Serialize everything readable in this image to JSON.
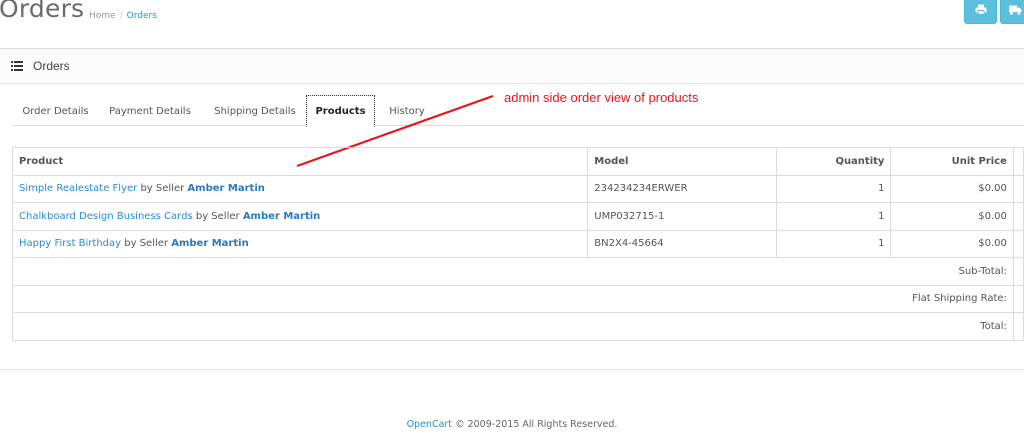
{
  "header": {
    "title": "Orders",
    "breadcrumb": {
      "home": "Home",
      "separator": "/",
      "current": "Orders"
    },
    "buttons": [
      {
        "name": "print-invoice",
        "icon": "print-icon"
      },
      {
        "name": "print-shipping",
        "icon": "truck-icon"
      }
    ]
  },
  "panel": {
    "icon": "list-icon",
    "title": "Orders",
    "tabs": [
      "Order Details",
      "Payment Details",
      "Shipping Details",
      "Products",
      "History"
    ],
    "active_tab": "Products"
  },
  "annotation": {
    "text": "admin side order view of products",
    "color": "#e8141e"
  },
  "products_table": {
    "columns": [
      "Product",
      "Model",
      "Quantity",
      "Unit Price"
    ],
    "rows": [
      {
        "product": "Simple Realestate Flyer",
        "by": "by Seller",
        "seller": "Amber Martin",
        "model": "234234234ERWER",
        "quantity": "1",
        "unit_price": "$0.00"
      },
      {
        "product": "Chalkboard Design Business Cards",
        "by": "by Seller",
        "seller": "Amber Martin",
        "model": "UMP032715-1",
        "quantity": "1",
        "unit_price": "$0.00"
      },
      {
        "product": "Happy First Birthday",
        "by": "by Seller",
        "seller": "Amber Martin",
        "model": "BN2X4-45664",
        "quantity": "1",
        "unit_price": "$0.00"
      }
    ],
    "totals": [
      "Sub-Total:",
      "Flat Shipping Rate:",
      "Total:"
    ]
  },
  "footer": {
    "link": "OpenCart",
    "text": "© 2009-2015 All Rights Reserved."
  },
  "colors": {
    "link": "#2a8bd1",
    "info_button": "#5bc0de",
    "annotation": "#e8141e"
  }
}
